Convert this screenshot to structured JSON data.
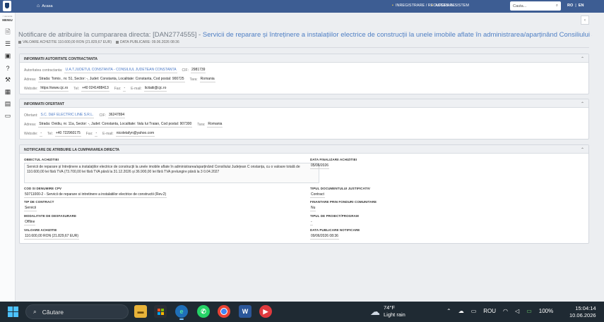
{
  "nav": {
    "home_label": "Acasa",
    "register_label": "INREGISTRARE / RECUPERARE",
    "access_label": "ACCES IN SISTEM",
    "search_placeholder": "Cauta...",
    "lang_ro": "RO",
    "lang_sep": "|",
    "lang_en": "EN"
  },
  "sidebar": {
    "menu_small": "< ascunde",
    "menu_label": "MENIU",
    "icons": [
      "document-icon",
      "list-icon",
      "form-icon",
      "help-icon",
      "tools-icon",
      "calculator-icon",
      "table-icon",
      "chat-icon"
    ]
  },
  "page": {
    "title_prefix": "Notificare de atribuire la cumpararea directa: [DAN2774555] - ",
    "title_main": "Servicii de reparare și întreținere a instalațiilor electrice de construcții la unele imobile aflate în administrarea/aparținând Consiliului Județean C...",
    "valoare_label": "VALOARE ACHIZITIE",
    "valoare": "110.600,00 RON (21.829,67 EUR)",
    "data_label": "DATA PUBLICARE:",
    "data": "09.06.2026 08:36",
    "collapse_icon": "‹"
  },
  "autoritate": {
    "header": "INFORMATII AUTORITATE CONTRACTANTA",
    "label_autoritate": "Autoritatea contractanta:",
    "autoritate": "U.A.T.JUDETUL CONSTANTA - CONSILIUL JUDETEAN CONSTANTA",
    "label_cif": "CIF:",
    "cif": "2981739",
    "label_adresa": "Adresa:",
    "adresa": "Strada: Tomis , nr. 51, Sector: -, Judet: Constanta, Localitate: Constanta, Cod postal: 900725",
    "label_tara": "Tara:",
    "tara": "Romania",
    "label_website": "Website:",
    "website": "https://www.cjc.ro",
    "label_tel": "Tel:",
    "tel": "+40 0241488413",
    "label_fax": "Fax:",
    "fax": "-",
    "label_email": "E-mail:",
    "email": "licitatii@cjc.ro"
  },
  "ofertant": {
    "header": "INFORMATII OFERTANT",
    "label_ofertant": "Ofertant:",
    "ofertant": "S.C. D&F ELECTRIC LINE S.R.L.",
    "label_cif": "CIF:",
    "cif": "36247894",
    "label_adresa": "Adresa:",
    "adresa": "Strada: Ovidiu, nr. 11a, Sector: -, Judet: Constanta, Localitate: Valu lui Traian, Cod postal: 907300",
    "label_tara": "Tara:",
    "tara": "Romania",
    "label_website": "Website:",
    "website": "-",
    "label_tel": "Tel:",
    "tel": "+40 722960175",
    "label_fax": "Fax:",
    "fax": "-",
    "label_email": "E-mail:",
    "email": "nicoletafyn@yahoo.com"
  },
  "notificare": {
    "header": "NOTIFICARE DE ATRIBUIRE LA CUMPARAREA DIRECTA",
    "obiect_label": "OBIECTUL ACHIZITIEI",
    "obiect": "Servicii de reparare și întreținere a instalațiilor electrice de construcții la unele imobile aflate în administrarea/aparținând Consiliului Județean C onstanța, cu o valoare totală de 110.600,00 lei fără TVA (73.700,00 lei fără TVA până la 31.12.2026 și 36.900,00 lei fără TVA prelungire până la 3 0.04.2027",
    "data_finalizare_label": "DATA FINALIZARII ACHIZITIEI",
    "data_finalizare": "05/06/2026",
    "cpv_label": "COD SI DENUMIRE CPV",
    "cpv": "50711000-2 - Servicii de reparare si intretinere a instalatiilor electrice de constructii (Rev.2)",
    "tip_document_label": "TIPUL DOCUMENTULUI JUSTIFICATIV",
    "tip_document": "Contract",
    "tip_contract_label": "TIP DE CONTRACT",
    "tip_contract": "Servicii",
    "fonduri_label": "FINANTARE PRIN FONDURI COMUNITARE",
    "fonduri": "Nu",
    "modalitate_label": "MODALITATE DE DESFASURARE",
    "modalitate": "Offline",
    "proiect_label": "TIPUL DE PROIECT/PROGRAM",
    "proiect": "-",
    "valoare_label": "VALOARE ACHIZITIE",
    "valoare": "110.600,00 RON (21.829,67 EUR)",
    "data_publicare_label": "DATA PUBLICARE NOTIFICARE",
    "data_publicare": "09/06/2026 08:36"
  },
  "taskbar": {
    "search_label": "Căutare",
    "weather_temp": "74°F",
    "weather_desc": "Light rain",
    "lang": "ROU",
    "battery": "100%",
    "time": "15:04:14",
    "date": "10.06.2026"
  }
}
